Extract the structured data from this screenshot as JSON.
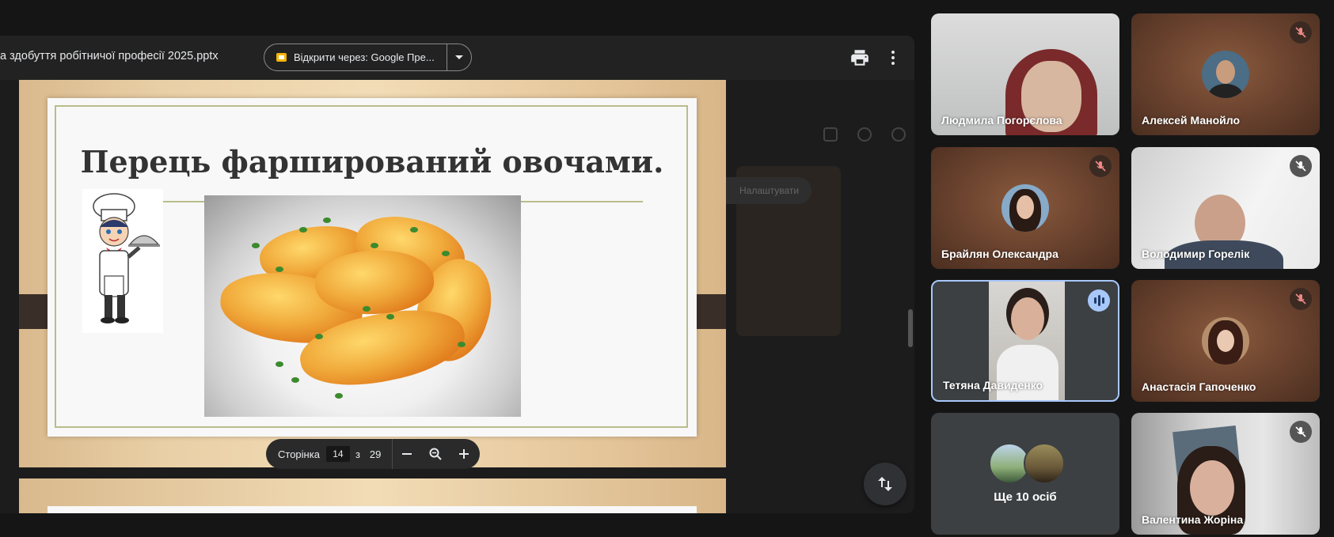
{
  "viewer": {
    "file_title": "а здобуття робітничої професії 2025.pptx",
    "open_with_label": "Відкрити через: Google Пре...",
    "print_icon": "print-icon",
    "more_icon": "more-vert-icon"
  },
  "background_ui": {
    "chip_label": "Налаштувати"
  },
  "slide": {
    "title": "Перець фарширований овочами."
  },
  "page_bar": {
    "label": "Сторінка",
    "current": "14",
    "of": "з",
    "total": "29"
  },
  "participants": [
    {
      "name": "Людмила Погорєлова",
      "muted": false
    },
    {
      "name": "Алексей Манойло",
      "muted": true
    },
    {
      "name": "Брайлян Олександра",
      "muted": true
    },
    {
      "name": "Володимир Горелік",
      "muted": true
    },
    {
      "name": "Тетяна Давиденко",
      "muted": false,
      "speaking": true
    },
    {
      "name": "Анастасія Гапоченко",
      "muted": true
    },
    {
      "name": "Ще 10 осіб",
      "muted": false
    },
    {
      "name": "Валентина Жоріна",
      "muted": true
    }
  ],
  "colors": {
    "speaking_border": "#a8c7fa",
    "background": "#151515",
    "slide_frame": "#e9cfa6"
  }
}
